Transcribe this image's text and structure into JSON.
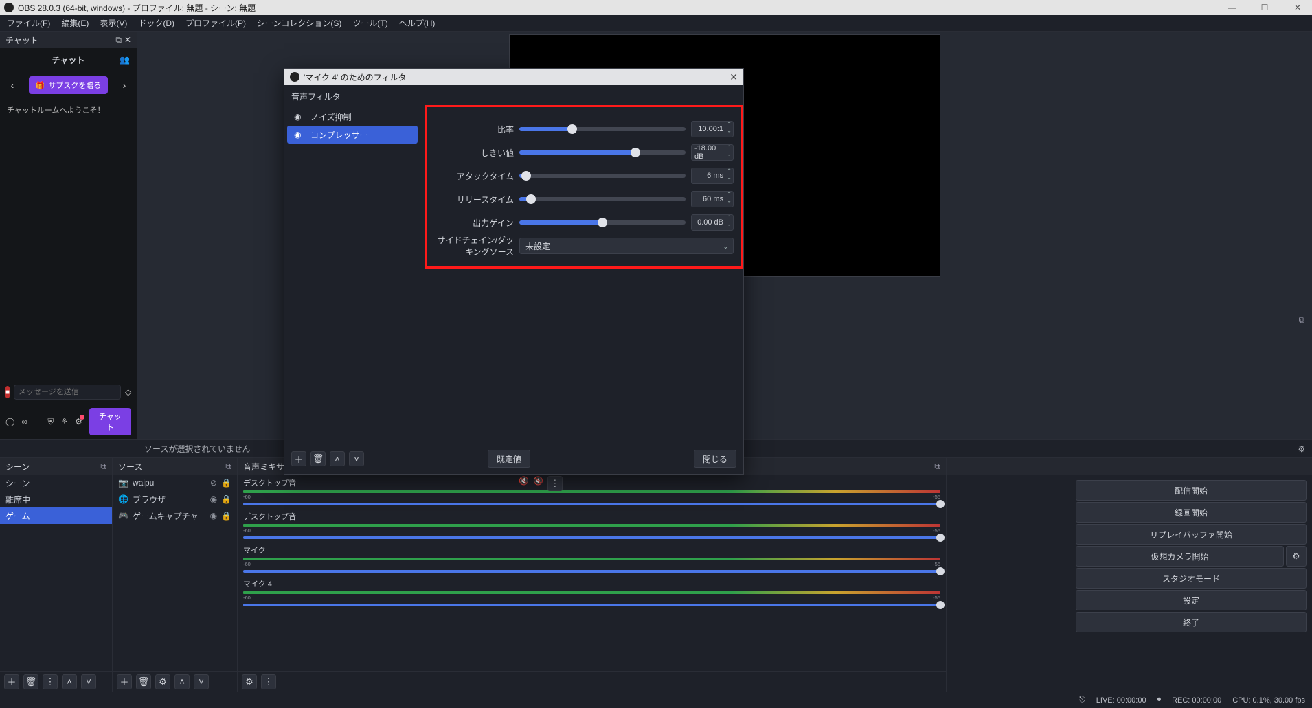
{
  "window_title": "OBS 28.0.3 (64-bit, windows) - プロファイル: 無題 - シーン: 無題",
  "menubar": [
    "ファイル(F)",
    "編集(E)",
    "表示(V)",
    "ドック(D)",
    "プロファイル(P)",
    "シーンコレクション(S)",
    "ツール(T)",
    "ヘルプ(H)"
  ],
  "chat": {
    "tab": "チャット",
    "header": "チャット",
    "gift_label": "サブスクを贈る",
    "welcome": "チャットルームへようこそ！",
    "msg_placeholder": "メッセージを送信",
    "send_label": "チャット"
  },
  "strip": {
    "no_source": "ソースが選択されていません"
  },
  "docks": {
    "scenes_title": "シーン",
    "sources_title": "ソース",
    "mixer_title": "音声ミキサ",
    "scenes": [
      {
        "label": "シーン",
        "active": false
      },
      {
        "label": "離席中",
        "active": false
      },
      {
        "label": "ゲーム",
        "active": true
      }
    ],
    "sources": [
      {
        "icon": "camera",
        "label": "waipu",
        "hidden": true
      },
      {
        "icon": "globe",
        "label": "ブラウザ",
        "hidden": false
      },
      {
        "icon": "gamepad",
        "label": "ゲームキャプチャ",
        "hidden": false
      }
    ],
    "mixer": [
      {
        "label": "デスクトップ音",
        "fill": 100
      },
      {
        "label": "デスクトップ音",
        "fill": 100
      },
      {
        "label": "マイク",
        "fill": 100
      },
      {
        "label": "マイク 4",
        "fill": 100
      }
    ],
    "meter_marks": [
      "-60",
      "-55"
    ]
  },
  "controls": {
    "start_stream": "配信開始",
    "start_rec": "録画開始",
    "replay_buffer": "リプレイバッファ開始",
    "virtual_cam": "仮想カメラ開始",
    "studio": "スタジオモード",
    "settings": "設定",
    "exit": "終了"
  },
  "statusbar": {
    "live": "LIVE: 00:00:00",
    "rec": "REC: 00:00:00",
    "cpu": "CPU: 0.1%, 30.00 fps"
  },
  "dialog": {
    "title": "'マイク 4' のためのフィルタ",
    "section": "音声フィルタ",
    "filters": [
      {
        "label": "ノイズ抑制",
        "selected": false
      },
      {
        "label": "コンプレッサー",
        "selected": true
      }
    ],
    "params": {
      "ratio_label": "比率",
      "ratio_value": "10.00:1",
      "ratio_pct": 32,
      "threshold_label": "しきい値",
      "threshold_value": "-18.00 dB",
      "threshold_pct": 70,
      "attack_label": "アタックタイム",
      "attack_value": "6 ms",
      "attack_pct": 4,
      "release_label": "リリースタイム",
      "release_value": "60 ms",
      "release_pct": 7,
      "gain_label": "出力ゲイン",
      "gain_value": "0.00 dB",
      "gain_pct": 50,
      "sidechain_label": "サイドチェイン/ダッキングソース",
      "sidechain_value": "未設定"
    },
    "defaults_btn": "既定値",
    "close_btn": "閉じる"
  }
}
